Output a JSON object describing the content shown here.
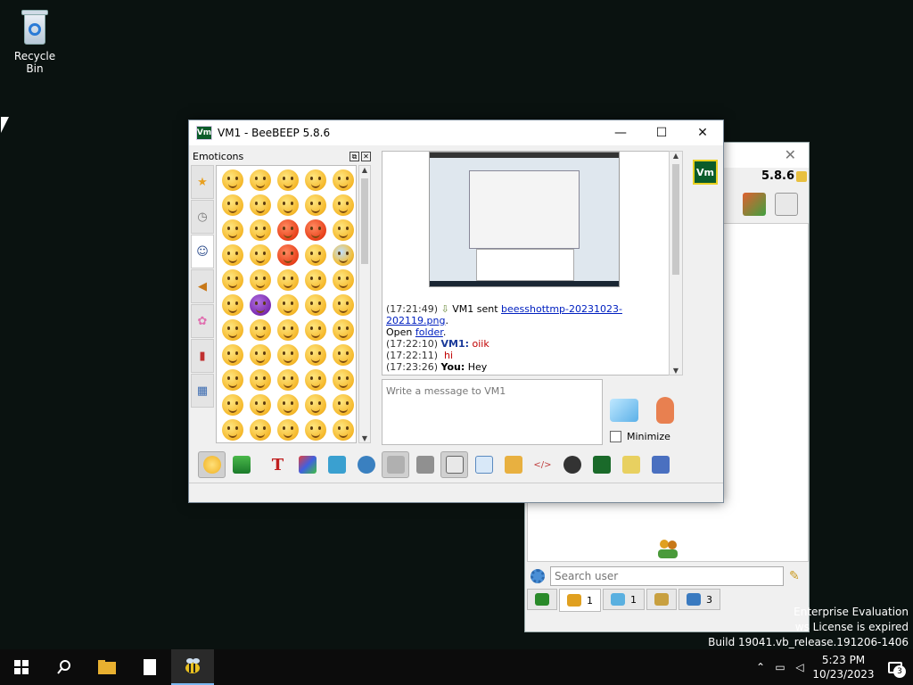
{
  "desktop": {
    "recycle_bin_label": "Recycle Bin"
  },
  "main_window": {
    "title": "VM1 - BeeBEEP 5.8.6",
    "logo_text": "Vm",
    "emoticons_label": "Emoticons",
    "chat_messages": [
      {
        "time": "(17:21:49)",
        "text_before": "VM1 sent",
        "file_link": "beesshottmp-20231023-202119.png",
        "text_after": ".",
        "line2_prefix": "Open",
        "line2_link": "folder",
        "line2_suffix": "."
      },
      {
        "time": "(17:22:10)",
        "sender": "VM1:",
        "text": "oiik"
      },
      {
        "time": "(17:22:11)",
        "text": "hi"
      },
      {
        "time": "(17:23:26)",
        "sender": "You:",
        "text": "Hey"
      }
    ],
    "compose_placeholder": "Write a message to VM1",
    "minimize_label": "Minimize",
    "side_logo": "Vm"
  },
  "back_window": {
    "version": "5.8.6",
    "search_placeholder": "Search user",
    "tabs": [
      {
        "icon": "chat-window-icon",
        "count": ""
      },
      {
        "icon": "users-icon",
        "count": "1"
      },
      {
        "icon": "chat-bubbles-icon",
        "count": "1"
      },
      {
        "icon": "groups-icon",
        "count": ""
      },
      {
        "icon": "file-share-icon",
        "count": "3"
      }
    ]
  },
  "watermark": {
    "line1": "Enterprise Evaluation",
    "line2": "ws License is expired",
    "line3": "Build 19041.vb_release.191206-1406"
  },
  "taskbar": {
    "time": "5:23 PM",
    "date": "10/23/2023",
    "notification_count": "3"
  }
}
